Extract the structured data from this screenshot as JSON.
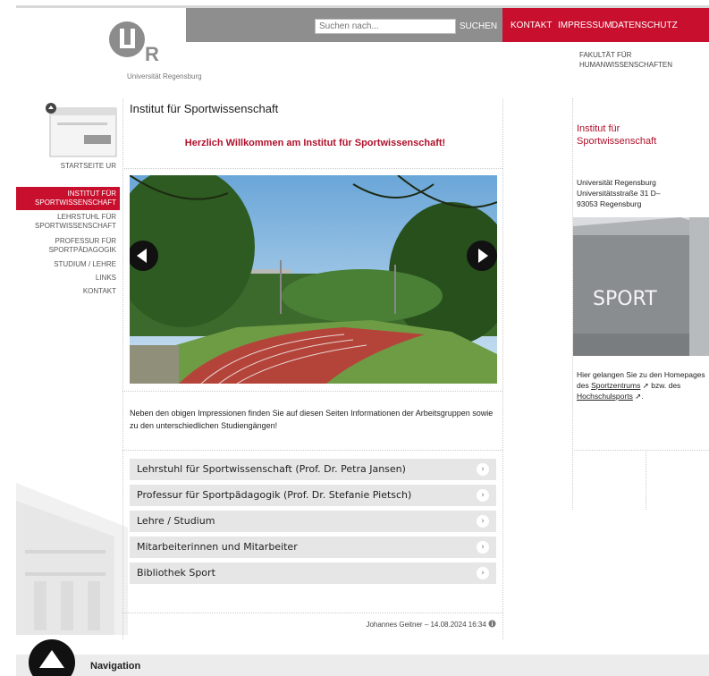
{
  "header": {
    "search": {
      "placeholder": "Suchen nach...",
      "button_label": "SUCHEN"
    },
    "top_links": [
      "KONTAKT",
      "IMPRESSUM",
      "DATENSCHUTZ"
    ],
    "logo_text": "Universität Regensburg",
    "faculty": [
      "FAKULTÄT FÜR",
      "HUMANWISSENSCHAFTEN"
    ]
  },
  "sidebar": {
    "home_label": "STARTSEITE UR",
    "active_item": [
      "INSTITUT FÜR",
      "SPORTWISSENSCHAFT"
    ],
    "items": [
      {
        "lines": [
          "LEHRSTUHL FÜR",
          "SPORTWISSENSCHAFT"
        ]
      },
      {
        "lines": [
          "PROFESSUR FÜR",
          "SPORTPÄDAGOGIK"
        ]
      },
      {
        "lines": [
          "STUDIUM / LEHRE"
        ]
      },
      {
        "lines": [
          "LINKS"
        ]
      },
      {
        "lines": [
          "KONTAKT"
        ]
      }
    ]
  },
  "main": {
    "title": "Institut für Sportwissenschaft",
    "welcome": "Herzlich Willkommen am Institut für Sportwissenschaft!",
    "intro": "Neben den obigen Impressionen finden Sie auf diesen Seiten Informationen der Arbeitsgruppen sowie zu den unterschiedlichen Studiengängen!",
    "accordion": [
      "Lehrstuhl für Sportwissenschaft (Prof. Dr. Petra Jansen)",
      "Professur für Sportpädagogik (Prof. Dr. Stefanie Pietsch)",
      "Lehre / Studium",
      "Mitarbeiterinnen und Mitarbeiter",
      "Bibliothek Sport"
    ],
    "chevron": "›",
    "footer_note": "Johannes Geitner – 14.08.2024 16:34"
  },
  "aside": {
    "title": "Institut für Sportwissenschaft",
    "address": [
      "Universität Regensburg",
      "Universitätsstraße 31   D–",
      "93053 Regensburg"
    ],
    "image_text": "SPORT",
    "text_prefix": "Hier gelangen Sie zu den Homepages des",
    "link1": "Sportzentrums",
    "text_mid": "bzw. des",
    "link2": "Hochschulsports",
    "text_end": "."
  },
  "bottom": {
    "nav_label": "Navigation"
  },
  "colors": {
    "brand_red": "#c8102e",
    "gray_bar": "#8e8e8e",
    "accordion_bg": "#e6e6e6"
  }
}
